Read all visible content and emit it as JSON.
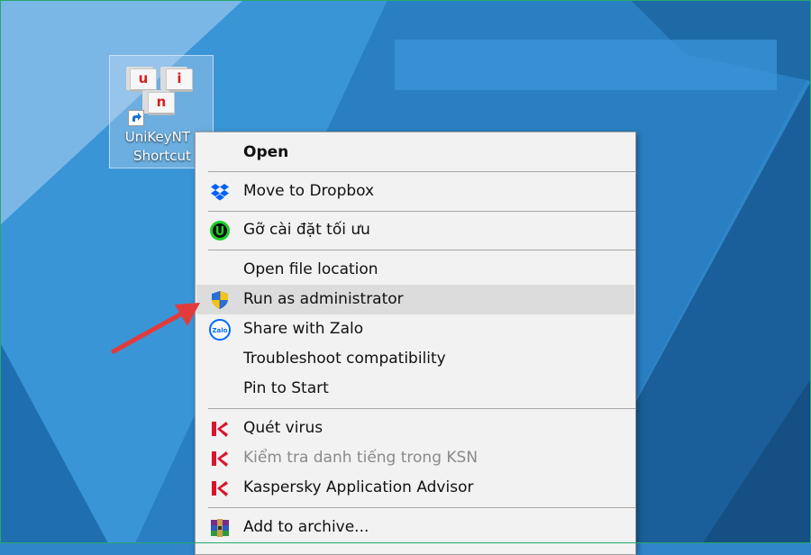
{
  "shortcut": {
    "name_line1": "UniKeyNT -",
    "name_line2": "Shortcut",
    "key_glyphs": [
      "u",
      "i",
      "n"
    ]
  },
  "context_menu": {
    "items": [
      {
        "label": "Open",
        "icon": null,
        "bold": true
      },
      {
        "label": "Move to Dropbox",
        "icon": "dropbox-icon"
      },
      {
        "label": "Gỡ cài đặt tối ưu",
        "icon": "uninstaller-icon"
      },
      {
        "label": "Open file location",
        "icon": null
      },
      {
        "label": "Run as administrator",
        "icon": "uac-shield-icon",
        "highlighted": true
      },
      {
        "label": "Share with Zalo",
        "icon": "zalo-icon"
      },
      {
        "label": "Troubleshoot compatibility",
        "icon": null
      },
      {
        "label": "Pin to Start",
        "icon": null
      },
      {
        "label": "Quét virus",
        "icon": "kaspersky-icon"
      },
      {
        "label": "Kiểm tra danh tiếng trong KSN",
        "icon": "kaspersky-icon",
        "disabled": true
      },
      {
        "label": "Kaspersky Application Advisor",
        "icon": "kaspersky-icon"
      },
      {
        "label": "Add to archive...",
        "icon": "winrar-icon"
      }
    ]
  },
  "annotation": {
    "icon": "red-pointer-arrow-icon",
    "target": "Run as administrator"
  },
  "colors": {
    "desktop_blue": "#2f86c8",
    "menu_background": "#f2f2f2",
    "highlight": "#dcdcdc",
    "separator": "#a6a6a6",
    "arrow_red": "#e23b3b",
    "zalo_icon": "#0068ff"
  }
}
